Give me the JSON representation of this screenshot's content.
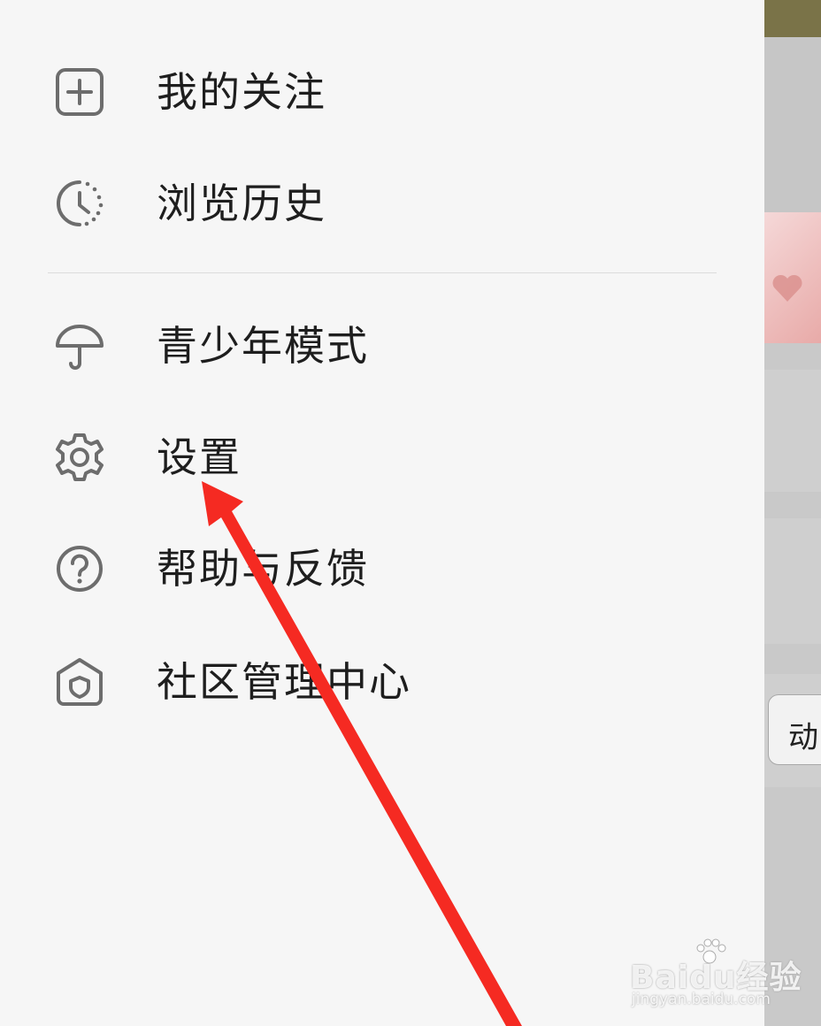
{
  "menu": {
    "items": [
      {
        "label": "我的关注",
        "icon": "plus-square-icon"
      },
      {
        "label": "浏览历史",
        "icon": "history-clock-icon"
      },
      {
        "label": "青少年模式",
        "icon": "umbrella-icon"
      },
      {
        "label": "设置",
        "icon": "gear-icon"
      },
      {
        "label": "帮助与反馈",
        "icon": "help-circle-icon"
      },
      {
        "label": "社区管理中心",
        "icon": "shield-home-icon"
      }
    ]
  },
  "background": {
    "button_partial_label": "动"
  },
  "watermark": {
    "main": "Baidu经验",
    "sub": "jingyan.baidu.com"
  },
  "colors": {
    "drawer_bg": "#f6f6f6",
    "icon": "#6d6d6d",
    "text": "#1e1e1e",
    "arrow": "#f52a22"
  }
}
